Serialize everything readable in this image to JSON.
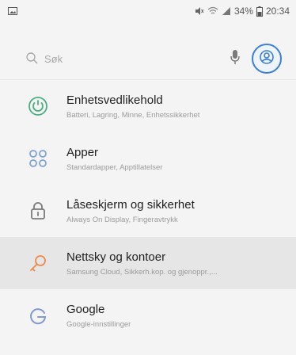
{
  "status_bar": {
    "left_icon": "image-icon",
    "battery_percent": "34%",
    "time": "20:34",
    "icons": [
      "mute-icon",
      "wifi-icon",
      "signal-icon",
      "battery-icon"
    ]
  },
  "search": {
    "placeholder": "Søk",
    "mic_icon": "mic-icon",
    "account_icon": "account-icon"
  },
  "settings": {
    "items": [
      {
        "title": "Enhetsvedlikehold",
        "subtitle": "Batteri, Lagring, Minne, Enhetssikkerhet",
        "icon": "device-maintenance-icon",
        "icon_color": "#4caf82",
        "active": false
      },
      {
        "title": "Apper",
        "subtitle": "Standardapper, Apptillatelser",
        "icon": "apps-icon",
        "icon_color": "#7fa2d8",
        "active": false
      },
      {
        "title": "Låseskjerm og sikkerhet",
        "subtitle": "Always On Display, Fingeravtrykk",
        "icon": "lock-icon",
        "icon_color": "#7a7a7a",
        "active": false
      },
      {
        "title": "Nettsky og kontoer",
        "subtitle": "Samsung Cloud, Sikkerh.kop. og gjenoppr.,...",
        "icon": "key-icon",
        "icon_color": "#f08a4b",
        "active": true
      },
      {
        "title": "Google",
        "subtitle": "Google-innstillinger",
        "icon": "google-icon",
        "icon_color": "#7f9bd4",
        "active": false
      }
    ]
  },
  "colors": {
    "background": "#f4f4f4",
    "active_row": "#e6e6e6",
    "accent": "#3d7fd4"
  }
}
